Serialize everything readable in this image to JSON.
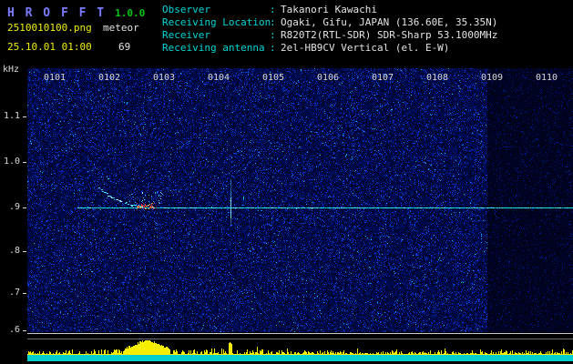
{
  "header": {
    "app_name": "H R O F F T",
    "version": "1.0.0",
    "filename": "2510010100.png",
    "mode": "meteor",
    "datetime": "25.10.01 01:00",
    "count": "69"
  },
  "info_panel": {
    "separator": ":",
    "rows": [
      {
        "label": "Observer",
        "value": "Takanori Kawachi"
      },
      {
        "label": "Receiving Location",
        "value": "Ogaki, Gifu, JAPAN (136.60E, 35.35N)"
      },
      {
        "label": "Receiver",
        "value": "R820T2(RTL-SDR) SDR-Sharp 53.1000MHz"
      },
      {
        "label": "Receiving antenna",
        "value": "2el-HB9CV Vertical (el. E-W)"
      }
    ]
  },
  "spectrogram": {
    "ylabel": "kHz",
    "yticks": [
      "1.1",
      "1.0",
      ".9",
      ".8",
      ".7",
      ".6"
    ],
    "xticks": [
      "0101",
      "0102",
      "0103",
      "0104",
      "0105",
      "0106",
      "0107",
      "0108",
      "0109",
      "0110"
    ],
    "carrier_khz": 0.9,
    "features": {
      "carrier_line": "continuous carrier line at ~0.9 kHz",
      "meteor_echo": "head echo with descending Doppler trail near 0102.4",
      "short_ping": "brief vertical echo near 0104.2",
      "quiet_region": "darker low-noise band after ~0108.4"
    }
  },
  "colors": {
    "background": "#000000",
    "title_text": "#7b7bff",
    "version_text": "#00c614",
    "yellow_text": "#efef12",
    "white_text": "#e4e4e4",
    "cyan_text": "#00d7d7",
    "noise_blue": "#1e1ec8",
    "carrier_cyan": "#17e6e6",
    "echo_red": "#e23323",
    "level_bars": "#f5ee00",
    "bottom_band": "#00cfcf"
  }
}
